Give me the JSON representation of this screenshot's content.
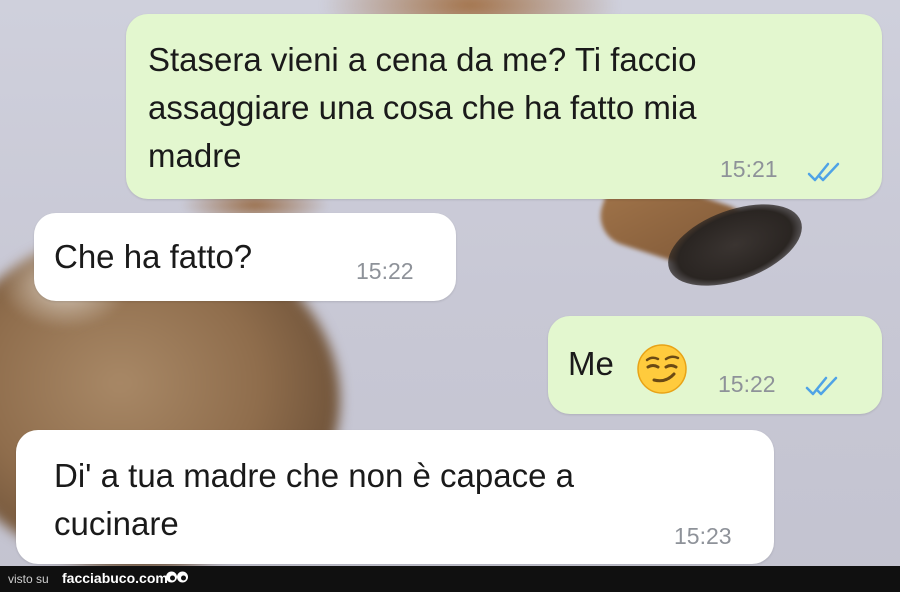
{
  "messages": [
    {
      "direction": "outgoing",
      "text": "Stasera vieni a cena da me? Ti faccio\nassaggiare una cosa che ha fatto mia\nmadre",
      "time": "15:21",
      "status": "read"
    },
    {
      "direction": "incoming",
      "text": "Che ha fatto?",
      "time": "15:22"
    },
    {
      "direction": "outgoing",
      "text": "Me",
      "emoji": "smirk-emoji",
      "time": "15:22",
      "status": "read"
    },
    {
      "direction": "incoming",
      "text": "Di' a tua madre che non è capace a\ncucinare",
      "time": "15:23"
    }
  ],
  "footer": {
    "prefix": "visto su",
    "site": "facciabuco.com"
  },
  "colors": {
    "outgoing_bubble": "#e3f7cf",
    "incoming_bubble": "#ffffff",
    "read_ticks": "#4fa3e6",
    "timestamp": "#8e9299"
  }
}
